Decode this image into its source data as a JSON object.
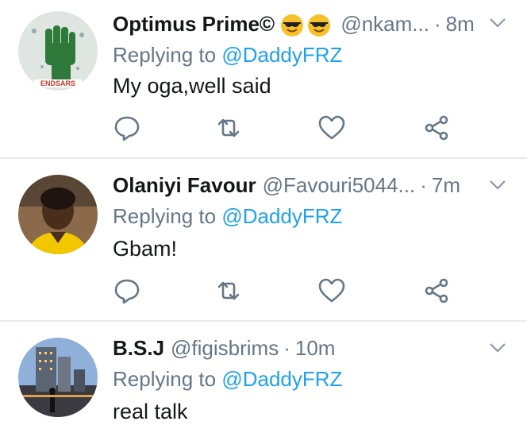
{
  "colors": {
    "link": "#1da1f2",
    "secondary_text": "#657786",
    "primary_text": "#14171a",
    "divider": "#e6ecf0",
    "icon": "#657786"
  },
  "tweets": [
    {
      "name": "Optimus Prime©",
      "name_emojis": [
        "smiling-face-with-sunglasses-icon",
        "smiling-face-with-sunglasses-icon"
      ],
      "handle": "@nkam...",
      "separator": "·",
      "time": "8m",
      "replying_prefix": "Replying to ",
      "replying_to": "@DaddyFRZ",
      "text": "My oga,well said",
      "avatar_text": "ENDSARS"
    },
    {
      "name": "Olaniyi Favour",
      "handle": "@Favouri5044...",
      "separator": "·",
      "time": "7m",
      "replying_prefix": "Replying to ",
      "replying_to": "@DaddyFRZ",
      "text": "Gbam!"
    },
    {
      "name": "B.S.J",
      "handle": "@figisbrims",
      "separator": "·",
      "time": "10m",
      "replying_prefix": "Replying to ",
      "replying_to": "@DaddyFRZ",
      "text": "real talk"
    }
  ],
  "action_icons": [
    "reply-icon",
    "retweet-icon",
    "like-icon",
    "share-icon"
  ]
}
